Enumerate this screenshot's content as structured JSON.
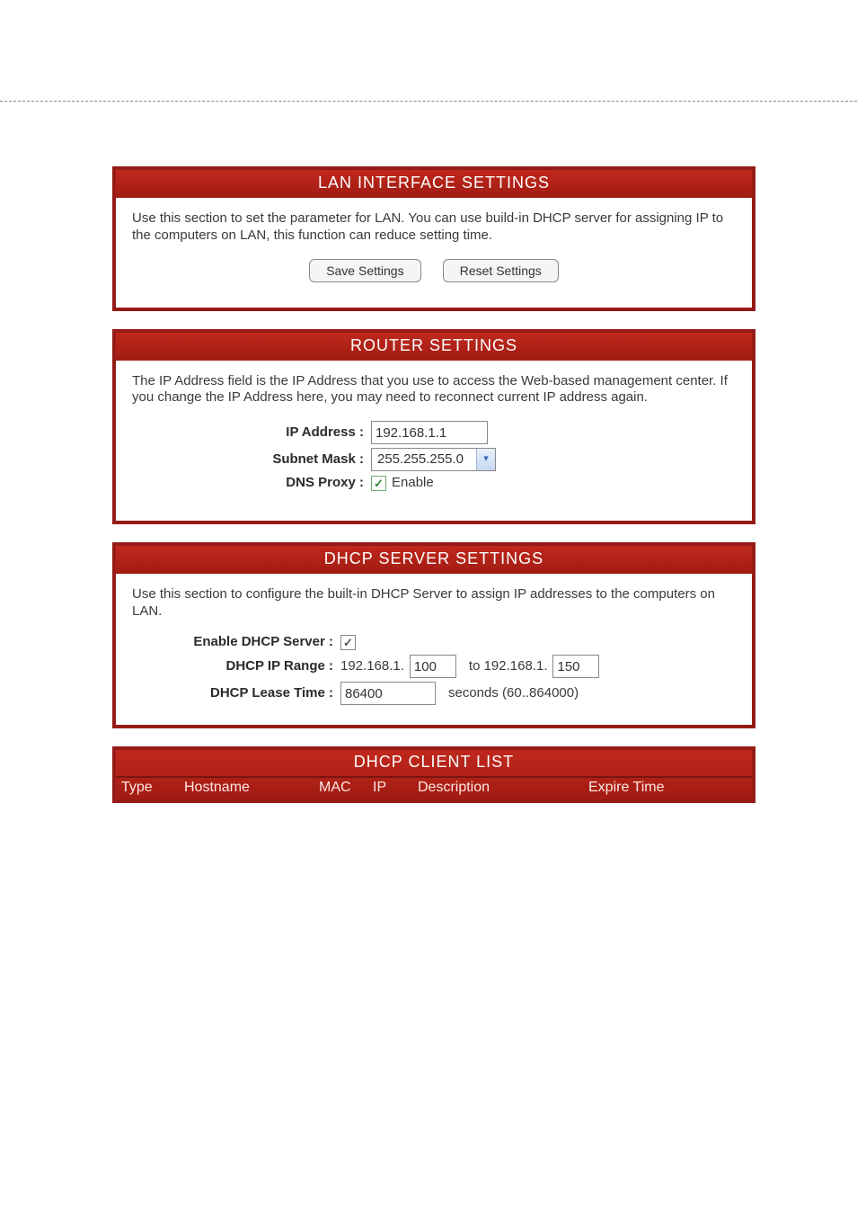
{
  "lan": {
    "title": "LAN INTERFACE SETTINGS",
    "desc": "Use this section to set the parameter for LAN. You can use build-in DHCP server for assigning IP to the computers on LAN, this function can reduce setting time.",
    "save_label": "Save Settings",
    "reset_label": "Reset Settings"
  },
  "router": {
    "title": "ROUTER SETTINGS",
    "desc": "The IP Address field is the IP Address that you use to access the Web-based management center. If you change the IP Address here, you may need to reconnect current IP address again.",
    "ip_label": "IP Address :",
    "ip_value": "192.168.1.1",
    "subnet_label": "Subnet Mask :",
    "subnet_value": "255.255.255.0",
    "dns_label": "DNS Proxy :",
    "dns_enable_label": "Enable",
    "dns_enable_checked": true
  },
  "dhcp": {
    "title": "DHCP SERVER SETTINGS",
    "desc": "Use this section to configure the built-in DHCP Server to assign IP addresses to the computers on LAN.",
    "enable_label": "Enable DHCP Server :",
    "enable_checked": true,
    "range_label": "DHCP IP Range :",
    "range_prefix1": "192.168.1.",
    "range_start": "100",
    "range_to": "to 192.168.1.",
    "range_end": "150",
    "lease_label": "DHCP Lease Time :",
    "lease_value": "86400",
    "lease_suffix": "seconds (60..864000)"
  },
  "client_list": {
    "title": "DHCP CLIENT LIST",
    "columns": {
      "type": "Type",
      "hostname": "Hostname",
      "mac": "MAC",
      "ip": "IP",
      "description": "Description",
      "expire": "Expire Time"
    }
  }
}
